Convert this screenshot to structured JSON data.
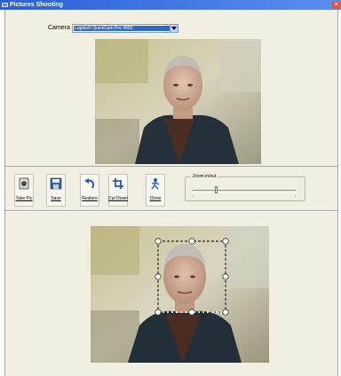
{
  "window": {
    "title": "Pictures Shooting"
  },
  "camera": {
    "label": "Camera",
    "selected": "Logitech QuickCam Pro 4000"
  },
  "toolbar": {
    "take_pic": "Take Pic",
    "save": "Save",
    "restore": "Restore",
    "cut_down": "Cut Down",
    "close": "Close"
  },
  "zoom": {
    "label": "Zoom in/out",
    "level": 0.22
  },
  "icons": {
    "take_pic": "camera-icon",
    "save": "floppy-disk-icon",
    "restore": "undo-arrow-icon",
    "cut_down": "crop-icon",
    "close": "person-exit-icon"
  },
  "colors": {
    "title_bar": "#2a5fd8",
    "window_bg": "#f1efe2",
    "selection_highlight": "#316ac5"
  }
}
